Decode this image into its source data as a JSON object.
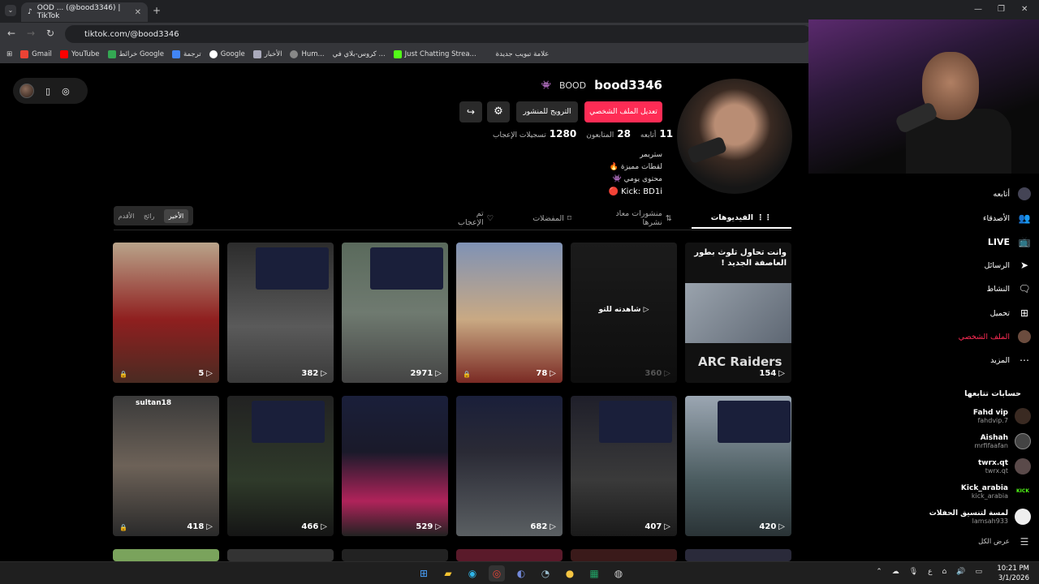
{
  "browser": {
    "tab_title": "OOD ... (@bood3346) | TikTok",
    "url": "tiktok.com/@bood3346",
    "bookmarks": [
      "Gmail",
      "YouTube",
      "خرائط Google",
      "ترجمة",
      "Google",
      "الأخبار",
      "Hum...",
      "كروس-بلاي في ...",
      "Just Chatting Strea...",
      "علامة تبويب جديدة"
    ]
  },
  "profile": {
    "username": "bood3346",
    "nickname": "BOOD",
    "edit_button": "تعديل الملف الشخصي",
    "promote_button": "الترويج للمنشور",
    "stats": [
      {
        "value": "11",
        "label": "أتابعه"
      },
      {
        "value": "28",
        "label": "المتابعون"
      },
      {
        "value": "1280",
        "label": "تسجيلات الإعجاب"
      }
    ],
    "bio": [
      "ستريمر",
      "لقطات مميزة 🔥",
      "محتوى يومي 👾",
      "Kick: BD1i 🔴"
    ]
  },
  "sort": {
    "items": [
      "الأخير",
      "رائج",
      "الأقدم"
    ],
    "active": "الأخير"
  },
  "content_tabs": [
    {
      "label": "الفيديوهات",
      "active": true
    },
    {
      "label": "منشورات معاد نشرها",
      "active": false
    },
    {
      "label": "المفضلات",
      "active": false
    },
    {
      "label": "تم الإعجاب",
      "active": false
    }
  ],
  "videos": [
    {
      "count": "154",
      "ad_title": "وانت تحاول تلوث بطور العاصفة الجديد !",
      "ad_brand": "ARC Raiders",
      "locked": false
    },
    {
      "count": "360",
      "overlay": "شاهدته للتو",
      "locked": false
    },
    {
      "count": "78",
      "locked": true
    },
    {
      "count": "2971",
      "locked": false
    },
    {
      "count": "382",
      "locked": false
    },
    {
      "count": "5",
      "locked": true
    },
    {
      "count": "420",
      "locked": false
    },
    {
      "count": "407",
      "locked": false
    },
    {
      "count": "682",
      "locked": false
    },
    {
      "count": "529",
      "locked": false
    },
    {
      "count": "466",
      "locked": false
    },
    {
      "count": "418",
      "locked": true,
      "caption": "sultan18"
    }
  ],
  "sidebar": {
    "items": [
      {
        "label": "أتابعه",
        "icon": "following-avatar-icon"
      },
      {
        "label": "الأصدقاء",
        "icon": "friends-icon"
      },
      {
        "label": "LIVE",
        "icon": "live-icon"
      },
      {
        "label": "الرسائل",
        "icon": "messages-icon"
      },
      {
        "label": "النشاط",
        "icon": "activity-icon"
      },
      {
        "label": "تحميل",
        "icon": "upload-icon"
      },
      {
        "label": "الملف الشخصي",
        "icon": "profile-avatar-icon"
      },
      {
        "label": "المزيد",
        "icon": "more-icon"
      }
    ],
    "following_title": "حسابات تتابعها",
    "accounts": [
      {
        "name": "Fahd vip",
        "handle": "fahdvip.7"
      },
      {
        "name": "Aishah",
        "handle": "mrfifaafan"
      },
      {
        "name": "twrx.qt",
        "handle": "twrx.qt"
      },
      {
        "name": "Kick_arabia",
        "handle": "kick_arabia"
      },
      {
        "name": "لمسة لتنسيق الحفلات",
        "handle": "lamsah933"
      }
    ],
    "see_all": "عرض الكل"
  },
  "taskbar": {
    "time": "10:21 PM",
    "date": "3/1/2026",
    "lang": "ع"
  },
  "colors": {
    "accent": "#fe2c55",
    "bg": "#000000"
  }
}
